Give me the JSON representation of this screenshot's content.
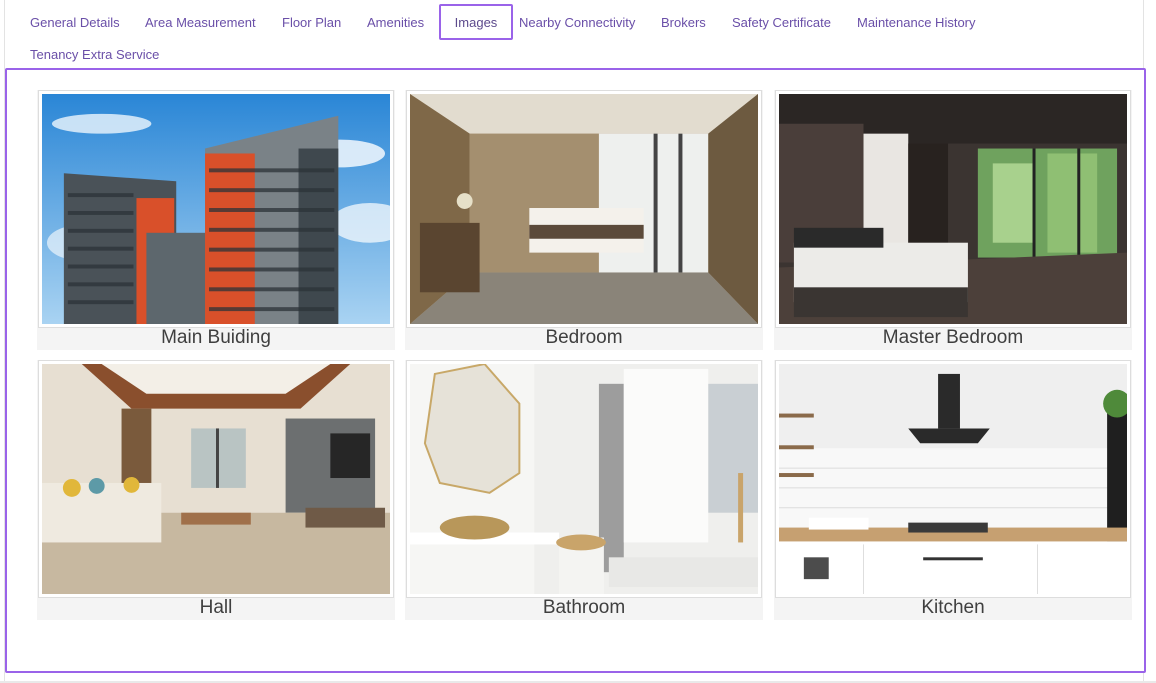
{
  "tabs": [
    {
      "label": "General Details"
    },
    {
      "label": "Area Measurement"
    },
    {
      "label": "Floor Plan"
    },
    {
      "label": "Amenities"
    },
    {
      "label": "Images",
      "active": true
    },
    {
      "label": "Nearby Connectivity"
    },
    {
      "label": "Brokers"
    },
    {
      "label": "Safety Certificate"
    },
    {
      "label": "Maintenance History"
    },
    {
      "label": "Tenancy Extra Service"
    }
  ],
  "gallery": [
    {
      "caption": "Main Buiding",
      "image": "building-exterior"
    },
    {
      "caption": "Bedroom",
      "image": "bedroom"
    },
    {
      "caption": "Master Bedroom",
      "image": "master-bedroom"
    },
    {
      "caption": "Hall",
      "image": "living-hall"
    },
    {
      "caption": "Bathroom",
      "image": "bathroom"
    },
    {
      "caption": "Kitchen",
      "image": "kitchen"
    }
  ],
  "colors": {
    "accent": "#9a63e9",
    "tab_text": "#6a4fa8",
    "caption_bg": "#f4f4f4"
  }
}
